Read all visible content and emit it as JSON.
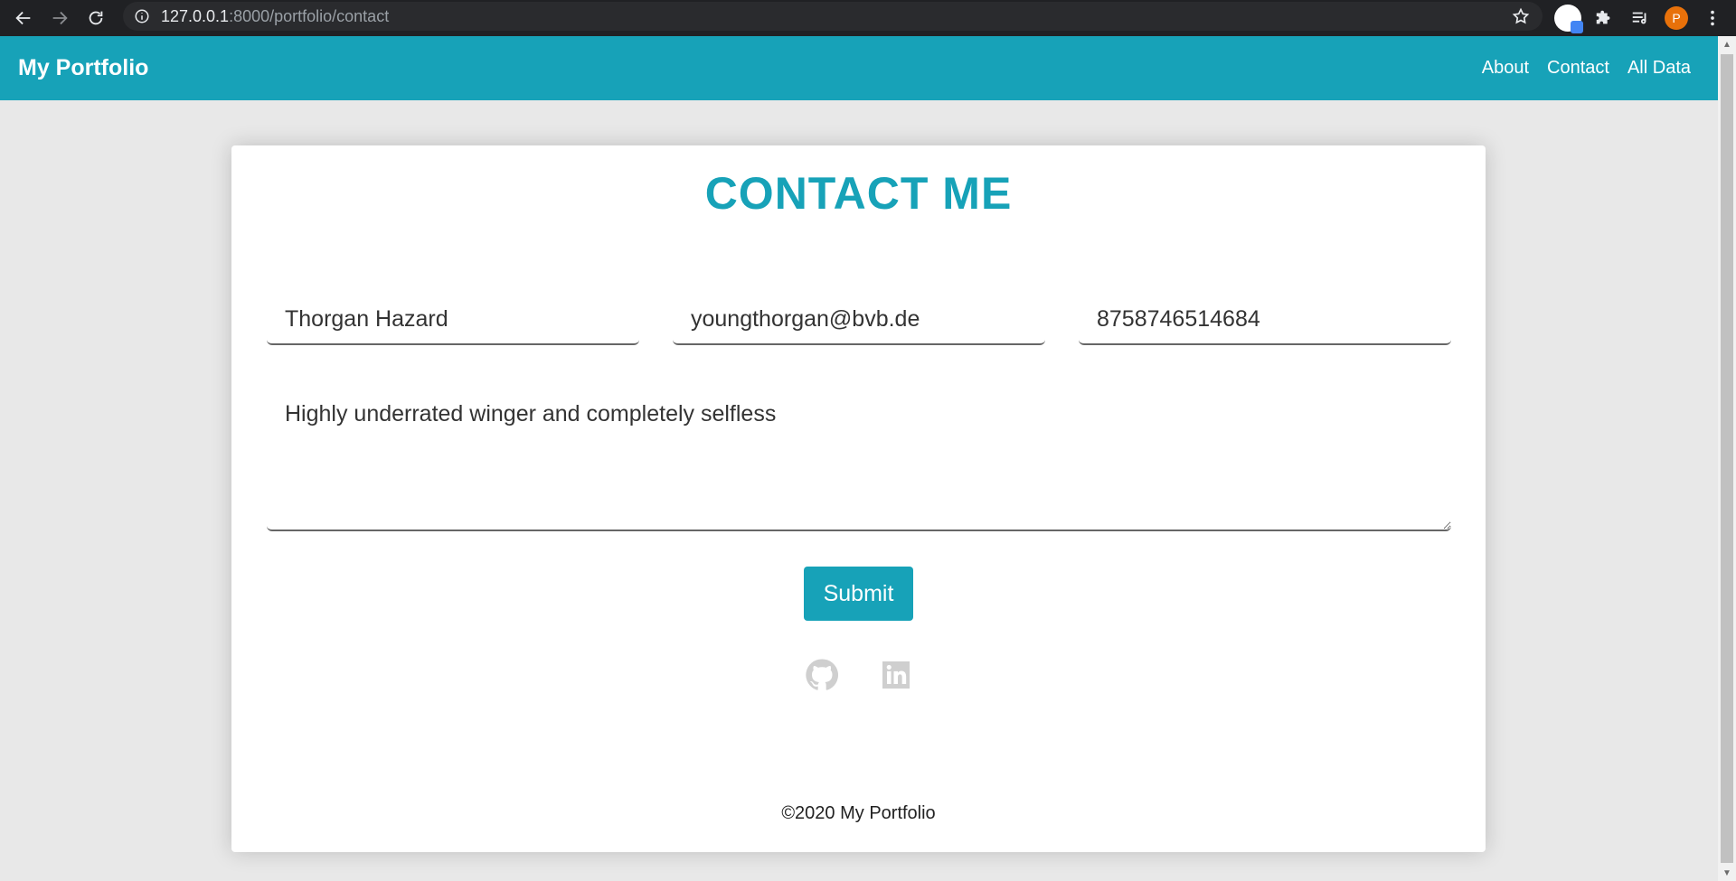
{
  "browser": {
    "url_host": "127.0.0.1",
    "url_path": ":8000/portfolio/contact",
    "avatar_letter": "P"
  },
  "navbar": {
    "brand": "My Portfolio",
    "links": [
      "About",
      "Contact",
      "All Data"
    ]
  },
  "contact": {
    "title": "CONTACT ME",
    "name_value": "Thorgan Hazard",
    "email_value": "youngthorgan@bvb.de",
    "phone_value": "8758746514684",
    "message_value": "Highly underrated winger and completely selfless",
    "submit_label": "Submit"
  },
  "footer": {
    "social_icons": [
      "github-icon",
      "linkedin-icon"
    ],
    "copyright": "©2020 My Portfolio"
  },
  "colors": {
    "accent": "#17a2b8",
    "page_bg": "#e8e8e8",
    "card_bg": "#ffffff",
    "chrome_bg": "#202124"
  }
}
